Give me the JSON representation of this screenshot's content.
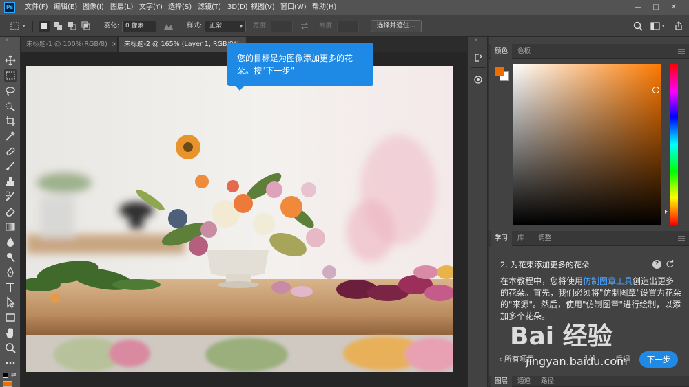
{
  "app": {
    "logo_text": "Ps",
    "menu": [
      "文件(F)",
      "编辑(E)",
      "图像(I)",
      "图层(L)",
      "文字(Y)",
      "选择(S)",
      "滤镜(T)",
      "3D(D)",
      "视图(V)",
      "窗口(W)",
      "帮助(H)"
    ],
    "window_controls": [
      "—",
      "□",
      "✕"
    ]
  },
  "options_bar": {
    "feather_label": "羽化:",
    "feather_value": "0 像素",
    "style_label": "样式:",
    "style_value": "正常",
    "width_label": "宽度:",
    "height_label": "高度:",
    "select_mask_button": "选择并遮住..."
  },
  "tabs": [
    {
      "title": "未标题-1 @ 100%(RGB/8)",
      "close": "×"
    },
    {
      "title": "未标题-2 @ 165% (Layer 1, RGB/8*)",
      "close": "×"
    }
  ],
  "tooltip": {
    "text": "您的目标是为图像添加更多的花朵。按\"下一步\""
  },
  "color_panel": {
    "tabs": [
      "颜色",
      "色板"
    ],
    "foreground": "#ee6c00",
    "background": "#ffffff"
  },
  "learn_panel": {
    "tabs": [
      "学习",
      "库",
      "调整"
    ],
    "step_title": "2.  为花束添加更多的花朵",
    "text_before_link": "在本教程中，您将使用",
    "link": "仿制图章工具",
    "text_after_link": "创造出更多的花朵。首先，我们必须将\"仿制图章\"设置为花朵的\"来源\"。然后，使用\"仿制图章\"进行绘制，以添加多个花朵。",
    "all_projects": "所有项目",
    "page": "1/4",
    "back": "后退",
    "next": "下一步"
  },
  "bottom_tabs": [
    "图层",
    "通道",
    "路径"
  ],
  "watermark": {
    "logo": "Bai 经验",
    "url": "jingyan.baidu.com"
  },
  "colors": {
    "accent": "#1f8ae5",
    "link": "#4aa3ff",
    "panel": "#424242",
    "chrome": "#535353"
  }
}
